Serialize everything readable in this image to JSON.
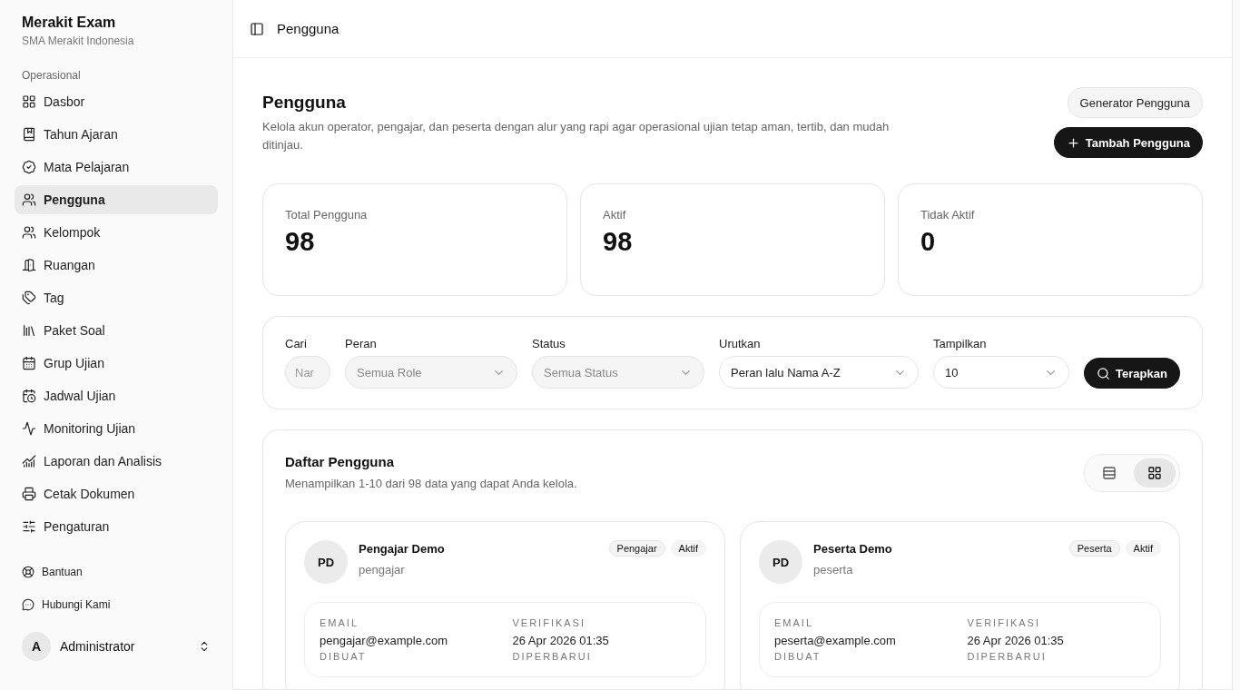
{
  "sidebar": {
    "app_name": "Merakit Exam",
    "school": "SMA Merakit Indonesia",
    "section": "Operasional",
    "items": [
      {
        "label": "Dasbor",
        "selected": false
      },
      {
        "label": "Tahun Ajaran",
        "selected": false
      },
      {
        "label": "Mata Pelajaran",
        "selected": false
      },
      {
        "label": "Pengguna",
        "selected": true
      },
      {
        "label": "Kelompok",
        "selected": false
      },
      {
        "label": "Ruangan",
        "selected": false
      },
      {
        "label": "Tag",
        "selected": false
      },
      {
        "label": "Paket Soal",
        "selected": false
      },
      {
        "label": "Grup Ujian",
        "selected": false
      },
      {
        "label": "Jadwal Ujian",
        "selected": false
      },
      {
        "label": "Monitoring Ujian",
        "selected": false
      },
      {
        "label": "Laporan dan Analisis",
        "selected": false
      },
      {
        "label": "Cetak Dokumen",
        "selected": false
      },
      {
        "label": "Pengaturan",
        "selected": false
      }
    ],
    "secondary": [
      {
        "label": "Bantuan"
      },
      {
        "label": "Hubungi Kami"
      }
    ],
    "user": {
      "initial": "A",
      "name": "Administrator"
    }
  },
  "topbar": {
    "title": "Pengguna"
  },
  "header": {
    "title": "Pengguna",
    "description": "Kelola akun operator, pengajar, dan peserta dengan alur yang rapi agar operasional ujian tetap aman, tertib, dan mudah ditinjau.",
    "buttons": [
      {
        "label": "Generator Pengguna",
        "kind": "secondary"
      },
      {
        "label": "Tambah Pengguna",
        "kind": "primary"
      }
    ]
  },
  "stats": [
    {
      "label": "Total Pengguna",
      "value": "98"
    },
    {
      "label": "Aktif",
      "value": "98"
    },
    {
      "label": "Tidak Aktif",
      "value": "0"
    }
  ],
  "filters": {
    "search": {
      "label": "Cari",
      "placeholder": "Nar"
    },
    "selects": [
      {
        "label": "Peran",
        "text": "Semua Role",
        "kind": "placeholder"
      },
      {
        "label": "Status",
        "text": "Semua Status",
        "kind": "placeholder"
      },
      {
        "label": "Urutkan",
        "text": "Peran lalu Nama A-Z",
        "kind": "value"
      },
      {
        "label": "Tampilkan",
        "text": "10",
        "kind": "value"
      }
    ],
    "apply": "Terapkan"
  },
  "list": {
    "title": "Daftar Pengguna",
    "subtitle": "Menampilkan 1-10 dari 98 data yang dapat Anda kelola.",
    "views": [
      {
        "selected": false
      },
      {
        "selected": true
      }
    ],
    "users": [
      {
        "initials": "PD",
        "name": "Pengajar Demo",
        "username": "pengajar",
        "badges": [
          "Pengajar",
          "Aktif"
        ],
        "fields": [
          {
            "label": "EMAIL",
            "value": "pengajar@example.com"
          },
          {
            "label": "VERIFIKASI",
            "value": "26 Apr 2026 01:35"
          },
          {
            "label": "DIBUAT"
          },
          {
            "label": "DIPERBARUI"
          }
        ]
      },
      {
        "initials": "PD",
        "name": "Peserta Demo",
        "username": "peserta",
        "badges": [
          "Peserta",
          "Aktif"
        ],
        "fields": [
          {
            "label": "EMAIL",
            "value": "peserta@example.com"
          },
          {
            "label": "VERIFIKASI",
            "value": "26 Apr 2026 01:35"
          },
          {
            "label": "DIBUAT"
          },
          {
            "label": "DIPERBARUI"
          }
        ]
      }
    ]
  }
}
